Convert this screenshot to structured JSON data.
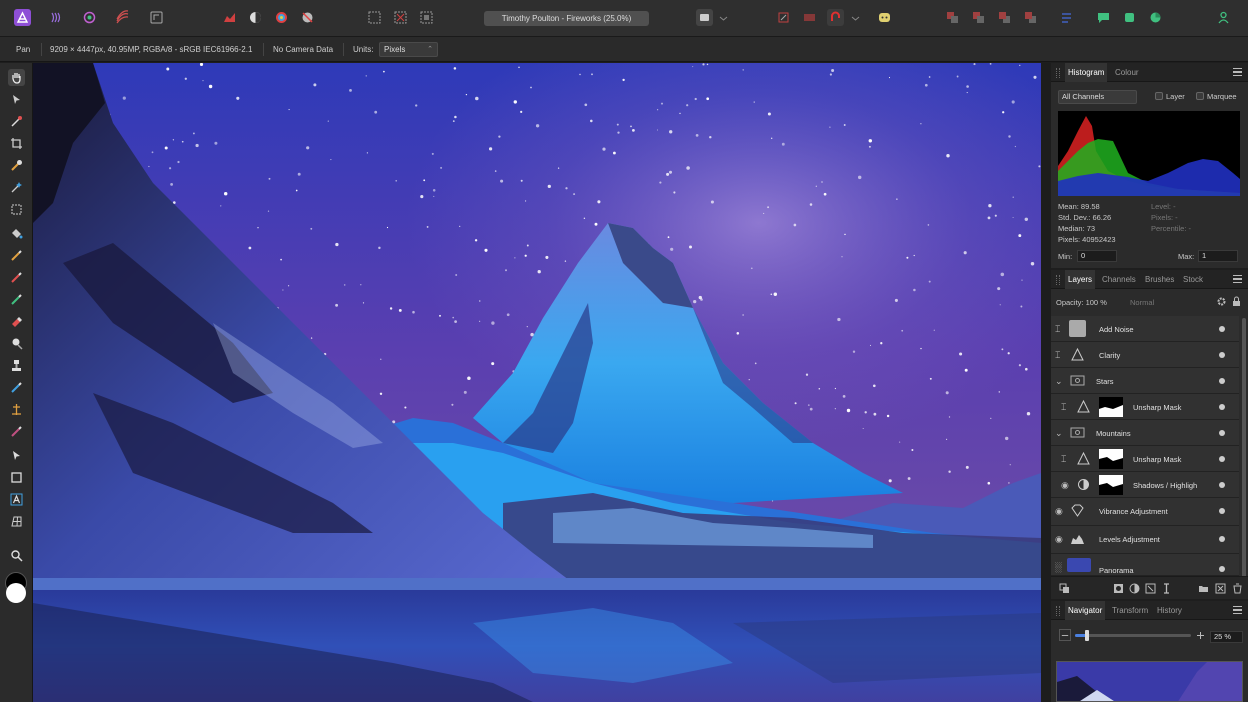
{
  "window": {
    "title": "Timothy Poulton - Fireworks (25.0%)"
  },
  "context_toolbar": {
    "tool": "Pan",
    "doc_info": "9209 × 4447px, 40.95MP, RGBA/8 - sRGB IEC61966-2.1",
    "camera": "No Camera Data",
    "units_label": "Units:",
    "units_value": "Pixels"
  },
  "histogram_panel": {
    "tabs": [
      "Histogram",
      "Colour"
    ],
    "channel": "All Channels",
    "layer_label": "Layer",
    "marquee_label": "Marquee",
    "stats": {
      "mean": "Mean: 89.58",
      "std": "Std. Dev.: 66.26",
      "median": "Median: 73",
      "pixels": "Pixels: 40952423",
      "level": "Level: -",
      "pix": "Pixels: -",
      "percentile": "Percentile: -"
    },
    "min_label": "Min:",
    "min_value": "0",
    "max_label": "Max:",
    "max_value": "1"
  },
  "layers_panel": {
    "tabs": [
      "Layers",
      "Channels",
      "Brushes",
      "Stock"
    ],
    "opacity": "Opacity: 100 %",
    "blend": "Normal",
    "layers": [
      {
        "name": "Add Noise"
      },
      {
        "name": "Clarity"
      },
      {
        "name": "Stars"
      },
      {
        "name": "Unsharp Mask"
      },
      {
        "name": "Mountains"
      },
      {
        "name": "Unsharp Mask"
      },
      {
        "name": "Shadows / Highligh"
      },
      {
        "name": "Vibrance Adjustment"
      },
      {
        "name": "Levels Adjustment"
      },
      {
        "name": "Panorama"
      }
    ]
  },
  "navigator_panel": {
    "tabs": [
      "Navigator",
      "Transform",
      "History"
    ],
    "zoom": "25 %"
  },
  "colors": {
    "accent": "#8e4fd6",
    "histogram_red": "#d02020",
    "histogram_green": "#20b020",
    "histogram_blue": "#2030c0"
  }
}
